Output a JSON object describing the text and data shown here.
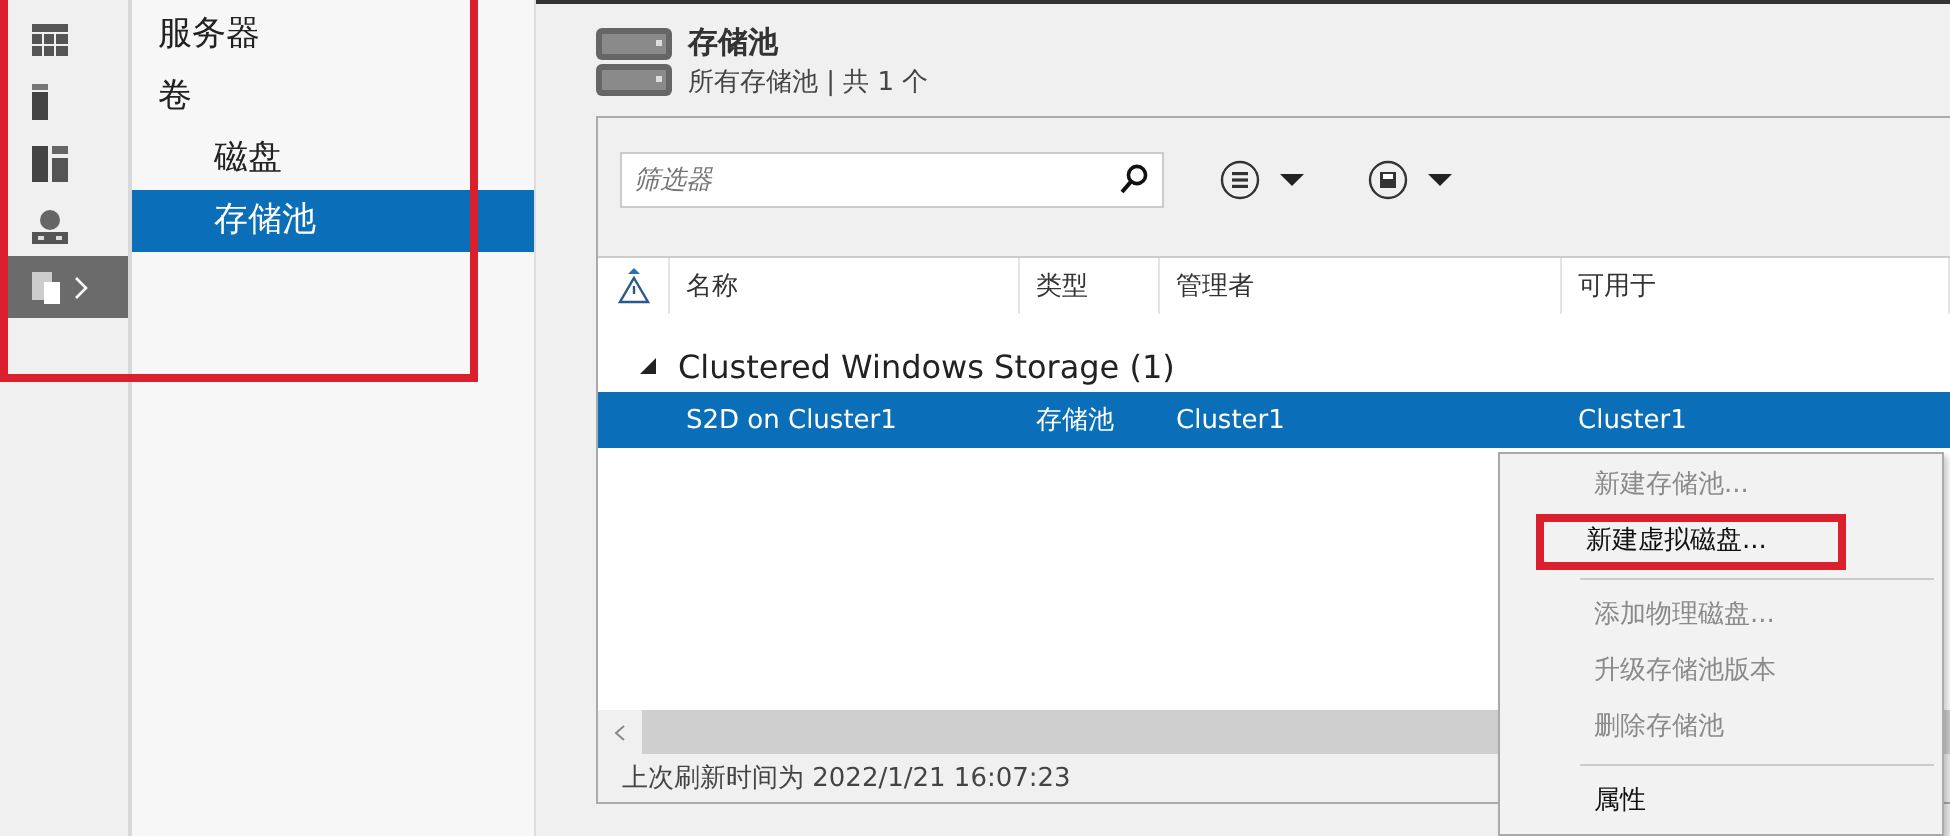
{
  "rail": {
    "highlighted": true,
    "items": [
      {
        "kind": "grid",
        "selected": false
      },
      {
        "kind": "server",
        "selected": false
      },
      {
        "kind": "tiles",
        "selected": false
      },
      {
        "kind": "globe",
        "selected": false
      },
      {
        "kind": "files",
        "selected": true
      }
    ]
  },
  "nav": {
    "items": [
      {
        "label": "服务器",
        "selected": false
      },
      {
        "label": "卷",
        "selected": false,
        "children": [
          {
            "label": "磁盘",
            "selected": false
          },
          {
            "label": "存储池",
            "selected": true
          }
        ]
      }
    ]
  },
  "header": {
    "title": "存储池",
    "subtitle": "所有存储池 | 共 1 个"
  },
  "filter": {
    "placeholder": "筛选器"
  },
  "columns": [
    {
      "label": "名称"
    },
    {
      "label": "类型"
    },
    {
      "label": "管理者"
    },
    {
      "label": "可用于"
    }
  ],
  "groups": [
    {
      "label": "Clustered Windows Storage (1)",
      "expanded": true,
      "rows": [
        {
          "cells": [
            "S2D on Cluster1",
            "存储池",
            "Cluster1",
            "Cluster1"
          ],
          "selected": true
        }
      ]
    }
  ],
  "status": "上次刷新时间为 2022/1/21 16:07:23",
  "context_menu": {
    "items": [
      {
        "kind": "item",
        "label": "新建存储池...",
        "disabled": true,
        "highlighted": false
      },
      {
        "kind": "item",
        "label": "新建虚拟磁盘...",
        "disabled": false,
        "highlighted": true
      },
      {
        "kind": "separator"
      },
      {
        "kind": "item",
        "label": "添加物理磁盘...",
        "disabled": true,
        "highlighted": false
      },
      {
        "kind": "item",
        "label": "升级存储池版本",
        "disabled": true,
        "highlighted": false
      },
      {
        "kind": "item",
        "label": "删除存储池",
        "disabled": true,
        "highlighted": false
      },
      {
        "kind": "separator"
      },
      {
        "kind": "item",
        "label": "属性",
        "disabled": false,
        "highlighted": false
      }
    ]
  }
}
